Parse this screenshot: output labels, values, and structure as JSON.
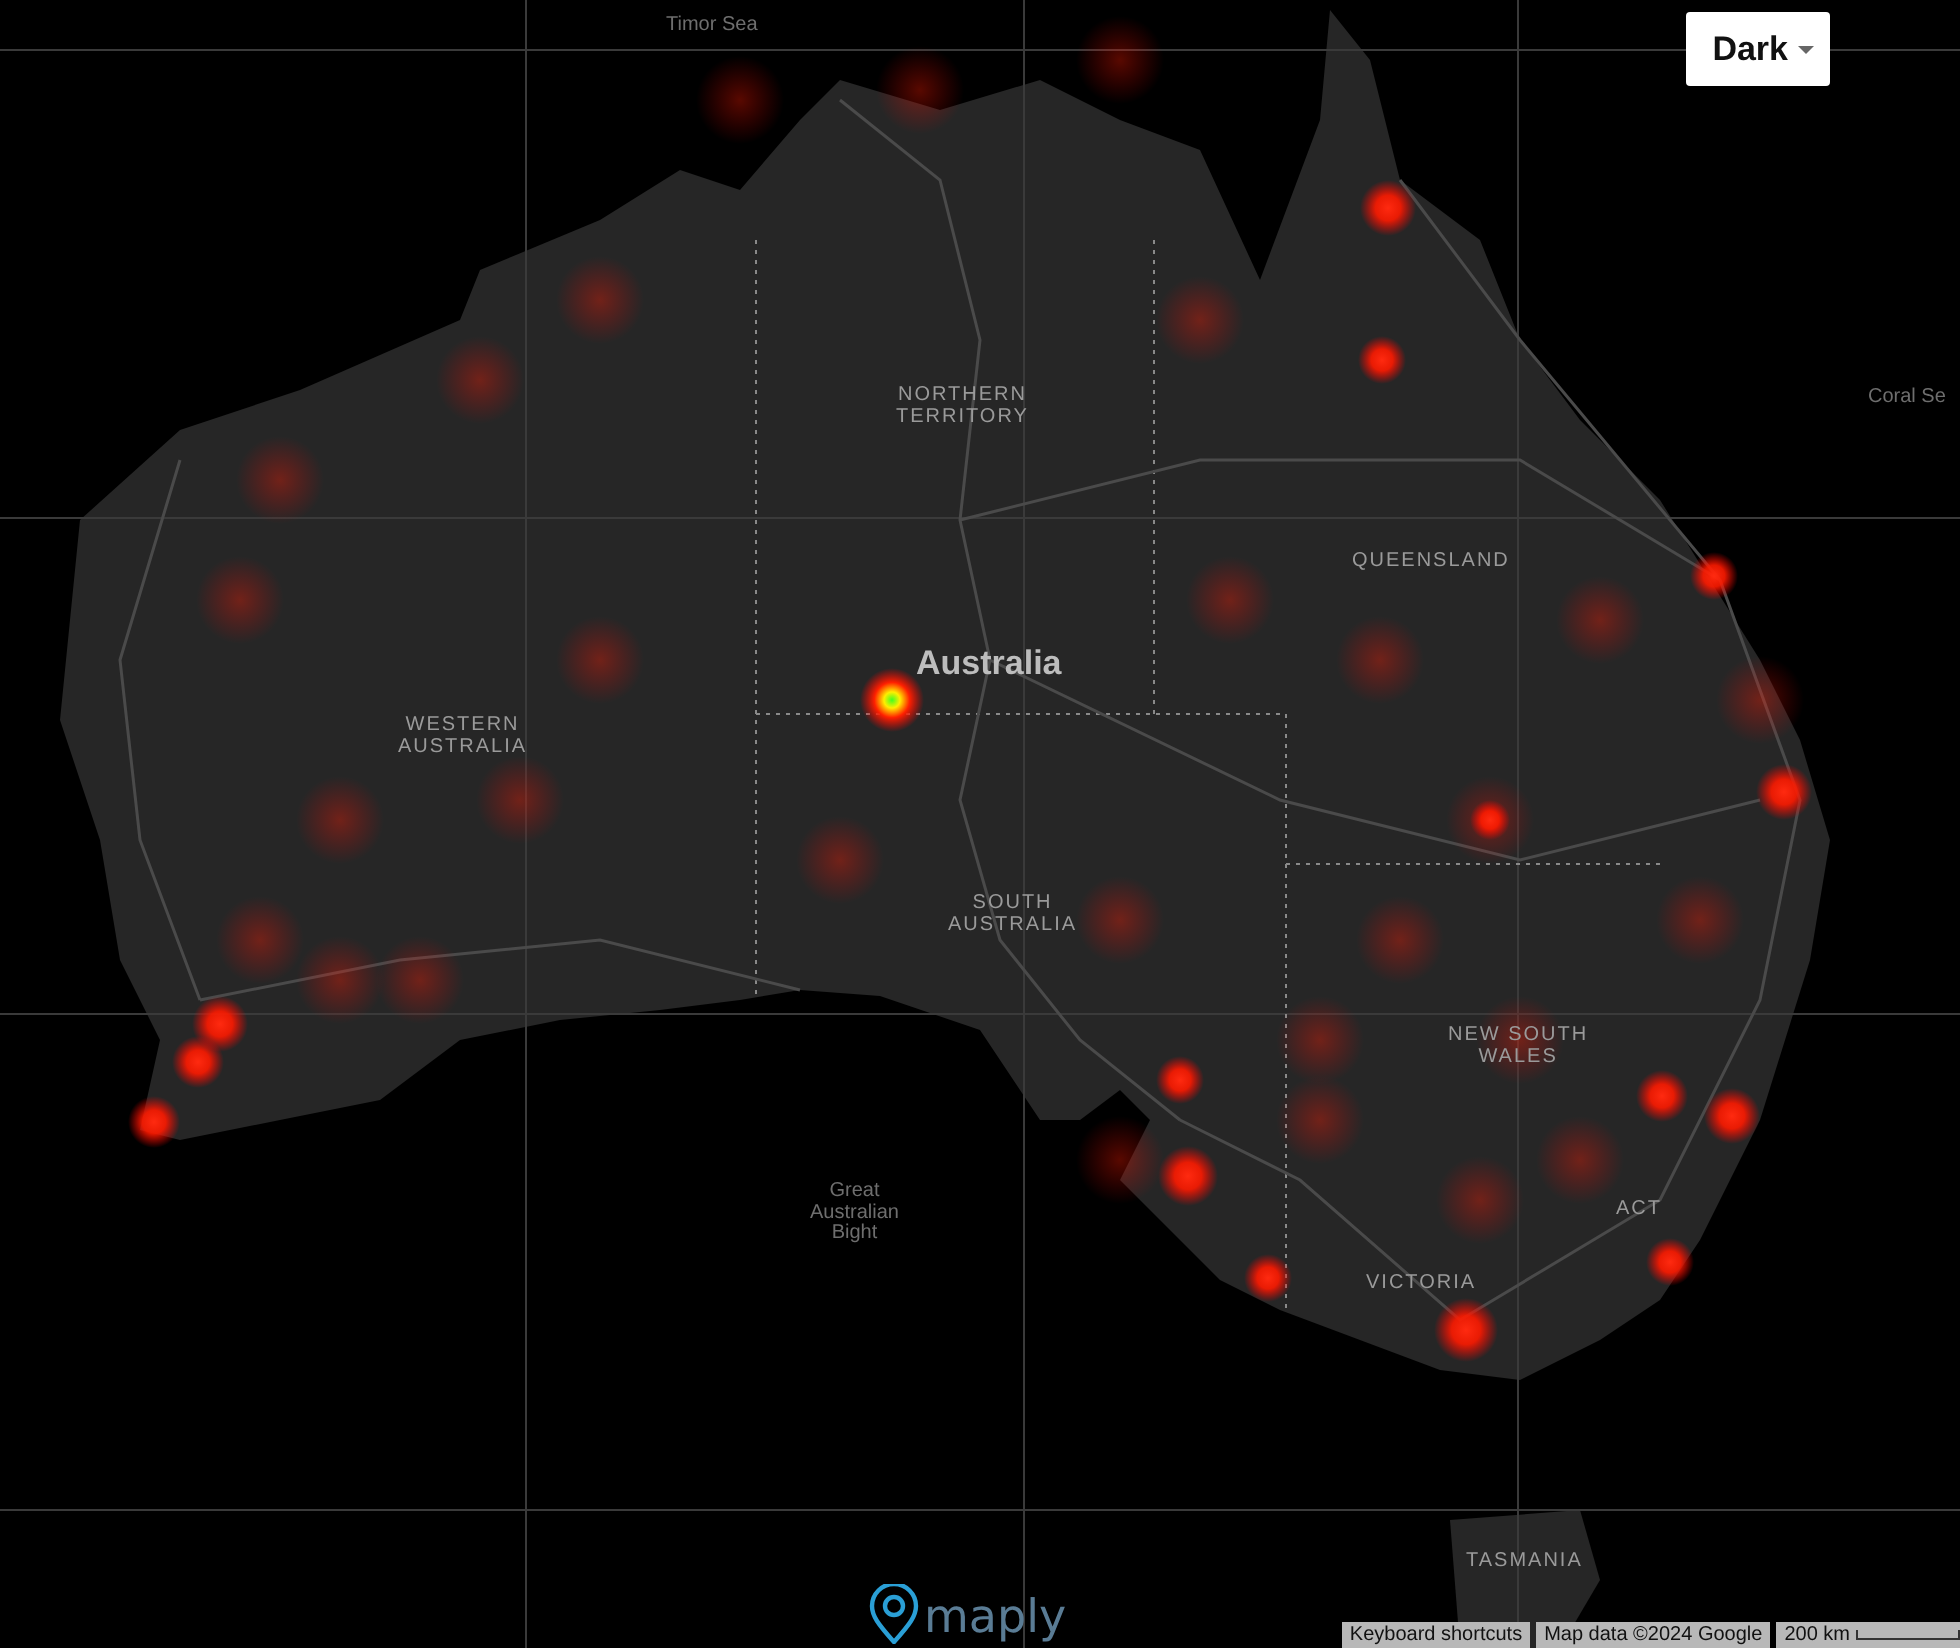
{
  "map": {
    "labels": [
      {
        "kind": "water",
        "text": "Timor Sea"
      },
      {
        "kind": "water",
        "text": "Coral Se"
      },
      {
        "kind": "region",
        "text": "NORTHERN\nTERRITORY"
      },
      {
        "kind": "region",
        "text": "QUEENSLAND"
      },
      {
        "kind": "region",
        "text": "WESTERN\nAUSTRALIA"
      },
      {
        "kind": "country",
        "text": "Australia"
      },
      {
        "kind": "region",
        "text": "SOUTH\nAUSTRALIA"
      },
      {
        "kind": "region",
        "text": "NEW SOUTH\nWALES"
      },
      {
        "kind": "region",
        "text": "ACT"
      },
      {
        "kind": "water",
        "text": "Great\nAustralian\nBight"
      },
      {
        "kind": "region",
        "text": "VICTORIA"
      },
      {
        "kind": "region",
        "text": "TASMANIA"
      }
    ]
  },
  "style_dropdown": {
    "value": "Dark"
  },
  "logo": {
    "text": "maply"
  },
  "attribution": {
    "shortcuts": "Keyboard shortcuts",
    "map_data": "Map data ©2024 Google",
    "scale": "200 km"
  }
}
